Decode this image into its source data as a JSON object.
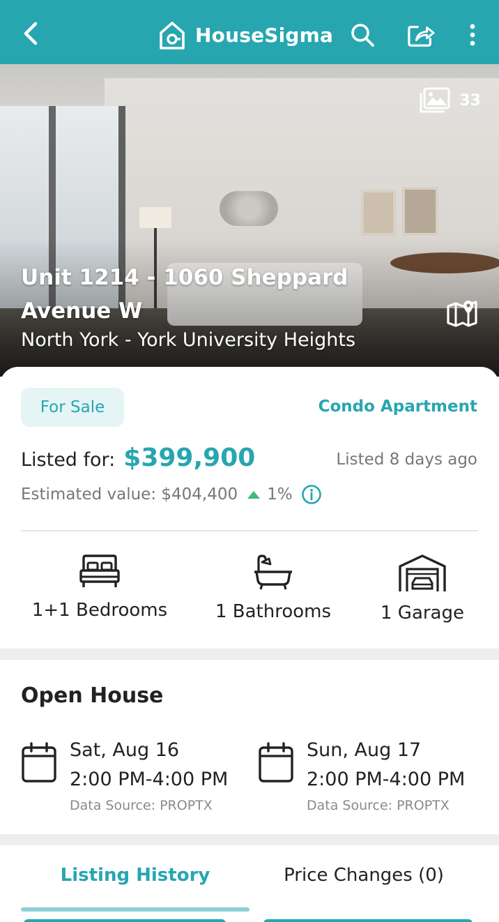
{
  "app": {
    "brand_name": "HouseSigma",
    "accent_color": "#27a6b0",
    "icons": {
      "back": "chevron-left-icon",
      "logo": "house-logo-icon",
      "search": "search-icon",
      "share": "share-icon",
      "more": "more-vertical-icon"
    }
  },
  "hero": {
    "photo_count": "33",
    "address_line1": "Unit 1214 - 1060 Sheppard Avenue W",
    "address_line2": "North York - York University Heights",
    "icons": {
      "gallery": "image-gallery-icon",
      "map": "map-icon"
    }
  },
  "listing": {
    "status_badge": "For Sale",
    "property_type": "Condo Apartment",
    "listed_label": "Listed for:",
    "price": "$399,900",
    "listed_ago": "Listed 8 days ago",
    "estimated_label": "Estimated value: $404,400",
    "estimated_change": "1%",
    "change_color": "#3fb97a"
  },
  "features": [
    {
      "label": "1+1 Bedrooms",
      "icon": "bed-icon"
    },
    {
      "label": "1 Bathrooms",
      "icon": "bathtub-icon"
    },
    {
      "label": "1 Garage",
      "icon": "garage-icon"
    }
  ],
  "open_house": {
    "title": "Open House",
    "items": [
      {
        "day": "Sat, Aug 16",
        "time": "2:00 PM-4:00 PM",
        "source": "Data Source: PROPTX"
      },
      {
        "day": "Sun, Aug 17",
        "time": "2:00 PM-4:00 PM",
        "source": "Data Source: PROPTX"
      }
    ]
  },
  "tabs": [
    {
      "label": "Listing History",
      "active": true
    },
    {
      "label": "Price Changes (0)",
      "active": false
    }
  ]
}
